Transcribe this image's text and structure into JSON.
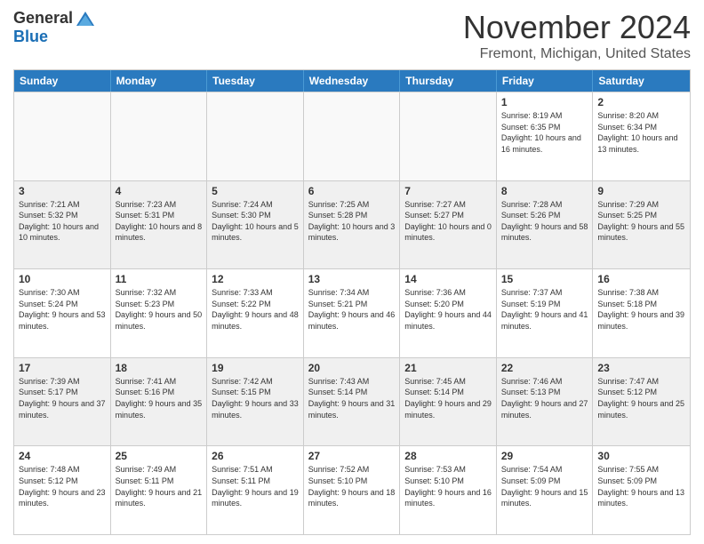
{
  "logo": {
    "general": "General",
    "blue": "Blue"
  },
  "title": "November 2024",
  "location": "Fremont, Michigan, United States",
  "days_of_week": [
    "Sunday",
    "Monday",
    "Tuesday",
    "Wednesday",
    "Thursday",
    "Friday",
    "Saturday"
  ],
  "weeks": [
    [
      {
        "day": "",
        "empty": true
      },
      {
        "day": "",
        "empty": true
      },
      {
        "day": "",
        "empty": true
      },
      {
        "day": "",
        "empty": true
      },
      {
        "day": "",
        "empty": true
      },
      {
        "day": "1",
        "sunrise": "Sunrise: 8:19 AM",
        "sunset": "Sunset: 6:35 PM",
        "daylight": "Daylight: 10 hours and 16 minutes."
      },
      {
        "day": "2",
        "sunrise": "Sunrise: 8:20 AM",
        "sunset": "Sunset: 6:34 PM",
        "daylight": "Daylight: 10 hours and 13 minutes."
      }
    ],
    [
      {
        "day": "3",
        "sunrise": "Sunrise: 7:21 AM",
        "sunset": "Sunset: 5:32 PM",
        "daylight": "Daylight: 10 hours and 10 minutes."
      },
      {
        "day": "4",
        "sunrise": "Sunrise: 7:23 AM",
        "sunset": "Sunset: 5:31 PM",
        "daylight": "Daylight: 10 hours and 8 minutes."
      },
      {
        "day": "5",
        "sunrise": "Sunrise: 7:24 AM",
        "sunset": "Sunset: 5:30 PM",
        "daylight": "Daylight: 10 hours and 5 minutes."
      },
      {
        "day": "6",
        "sunrise": "Sunrise: 7:25 AM",
        "sunset": "Sunset: 5:28 PM",
        "daylight": "Daylight: 10 hours and 3 minutes."
      },
      {
        "day": "7",
        "sunrise": "Sunrise: 7:27 AM",
        "sunset": "Sunset: 5:27 PM",
        "daylight": "Daylight: 10 hours and 0 minutes."
      },
      {
        "day": "8",
        "sunrise": "Sunrise: 7:28 AM",
        "sunset": "Sunset: 5:26 PM",
        "daylight": "Daylight: 9 hours and 58 minutes."
      },
      {
        "day": "9",
        "sunrise": "Sunrise: 7:29 AM",
        "sunset": "Sunset: 5:25 PM",
        "daylight": "Daylight: 9 hours and 55 minutes."
      }
    ],
    [
      {
        "day": "10",
        "sunrise": "Sunrise: 7:30 AM",
        "sunset": "Sunset: 5:24 PM",
        "daylight": "Daylight: 9 hours and 53 minutes."
      },
      {
        "day": "11",
        "sunrise": "Sunrise: 7:32 AM",
        "sunset": "Sunset: 5:23 PM",
        "daylight": "Daylight: 9 hours and 50 minutes."
      },
      {
        "day": "12",
        "sunrise": "Sunrise: 7:33 AM",
        "sunset": "Sunset: 5:22 PM",
        "daylight": "Daylight: 9 hours and 48 minutes."
      },
      {
        "day": "13",
        "sunrise": "Sunrise: 7:34 AM",
        "sunset": "Sunset: 5:21 PM",
        "daylight": "Daylight: 9 hours and 46 minutes."
      },
      {
        "day": "14",
        "sunrise": "Sunrise: 7:36 AM",
        "sunset": "Sunset: 5:20 PM",
        "daylight": "Daylight: 9 hours and 44 minutes."
      },
      {
        "day": "15",
        "sunrise": "Sunrise: 7:37 AM",
        "sunset": "Sunset: 5:19 PM",
        "daylight": "Daylight: 9 hours and 41 minutes."
      },
      {
        "day": "16",
        "sunrise": "Sunrise: 7:38 AM",
        "sunset": "Sunset: 5:18 PM",
        "daylight": "Daylight: 9 hours and 39 minutes."
      }
    ],
    [
      {
        "day": "17",
        "sunrise": "Sunrise: 7:39 AM",
        "sunset": "Sunset: 5:17 PM",
        "daylight": "Daylight: 9 hours and 37 minutes."
      },
      {
        "day": "18",
        "sunrise": "Sunrise: 7:41 AM",
        "sunset": "Sunset: 5:16 PM",
        "daylight": "Daylight: 9 hours and 35 minutes."
      },
      {
        "day": "19",
        "sunrise": "Sunrise: 7:42 AM",
        "sunset": "Sunset: 5:15 PM",
        "daylight": "Daylight: 9 hours and 33 minutes."
      },
      {
        "day": "20",
        "sunrise": "Sunrise: 7:43 AM",
        "sunset": "Sunset: 5:14 PM",
        "daylight": "Daylight: 9 hours and 31 minutes."
      },
      {
        "day": "21",
        "sunrise": "Sunrise: 7:45 AM",
        "sunset": "Sunset: 5:14 PM",
        "daylight": "Daylight: 9 hours and 29 minutes."
      },
      {
        "day": "22",
        "sunrise": "Sunrise: 7:46 AM",
        "sunset": "Sunset: 5:13 PM",
        "daylight": "Daylight: 9 hours and 27 minutes."
      },
      {
        "day": "23",
        "sunrise": "Sunrise: 7:47 AM",
        "sunset": "Sunset: 5:12 PM",
        "daylight": "Daylight: 9 hours and 25 minutes."
      }
    ],
    [
      {
        "day": "24",
        "sunrise": "Sunrise: 7:48 AM",
        "sunset": "Sunset: 5:12 PM",
        "daylight": "Daylight: 9 hours and 23 minutes."
      },
      {
        "day": "25",
        "sunrise": "Sunrise: 7:49 AM",
        "sunset": "Sunset: 5:11 PM",
        "daylight": "Daylight: 9 hours and 21 minutes."
      },
      {
        "day": "26",
        "sunrise": "Sunrise: 7:51 AM",
        "sunset": "Sunset: 5:11 PM",
        "daylight": "Daylight: 9 hours and 19 minutes."
      },
      {
        "day": "27",
        "sunrise": "Sunrise: 7:52 AM",
        "sunset": "Sunset: 5:10 PM",
        "daylight": "Daylight: 9 hours and 18 minutes."
      },
      {
        "day": "28",
        "sunrise": "Sunrise: 7:53 AM",
        "sunset": "Sunset: 5:10 PM",
        "daylight": "Daylight: 9 hours and 16 minutes."
      },
      {
        "day": "29",
        "sunrise": "Sunrise: 7:54 AM",
        "sunset": "Sunset: 5:09 PM",
        "daylight": "Daylight: 9 hours and 15 minutes."
      },
      {
        "day": "30",
        "sunrise": "Sunrise: 7:55 AM",
        "sunset": "Sunset: 5:09 PM",
        "daylight": "Daylight: 9 hours and 13 minutes."
      }
    ]
  ]
}
